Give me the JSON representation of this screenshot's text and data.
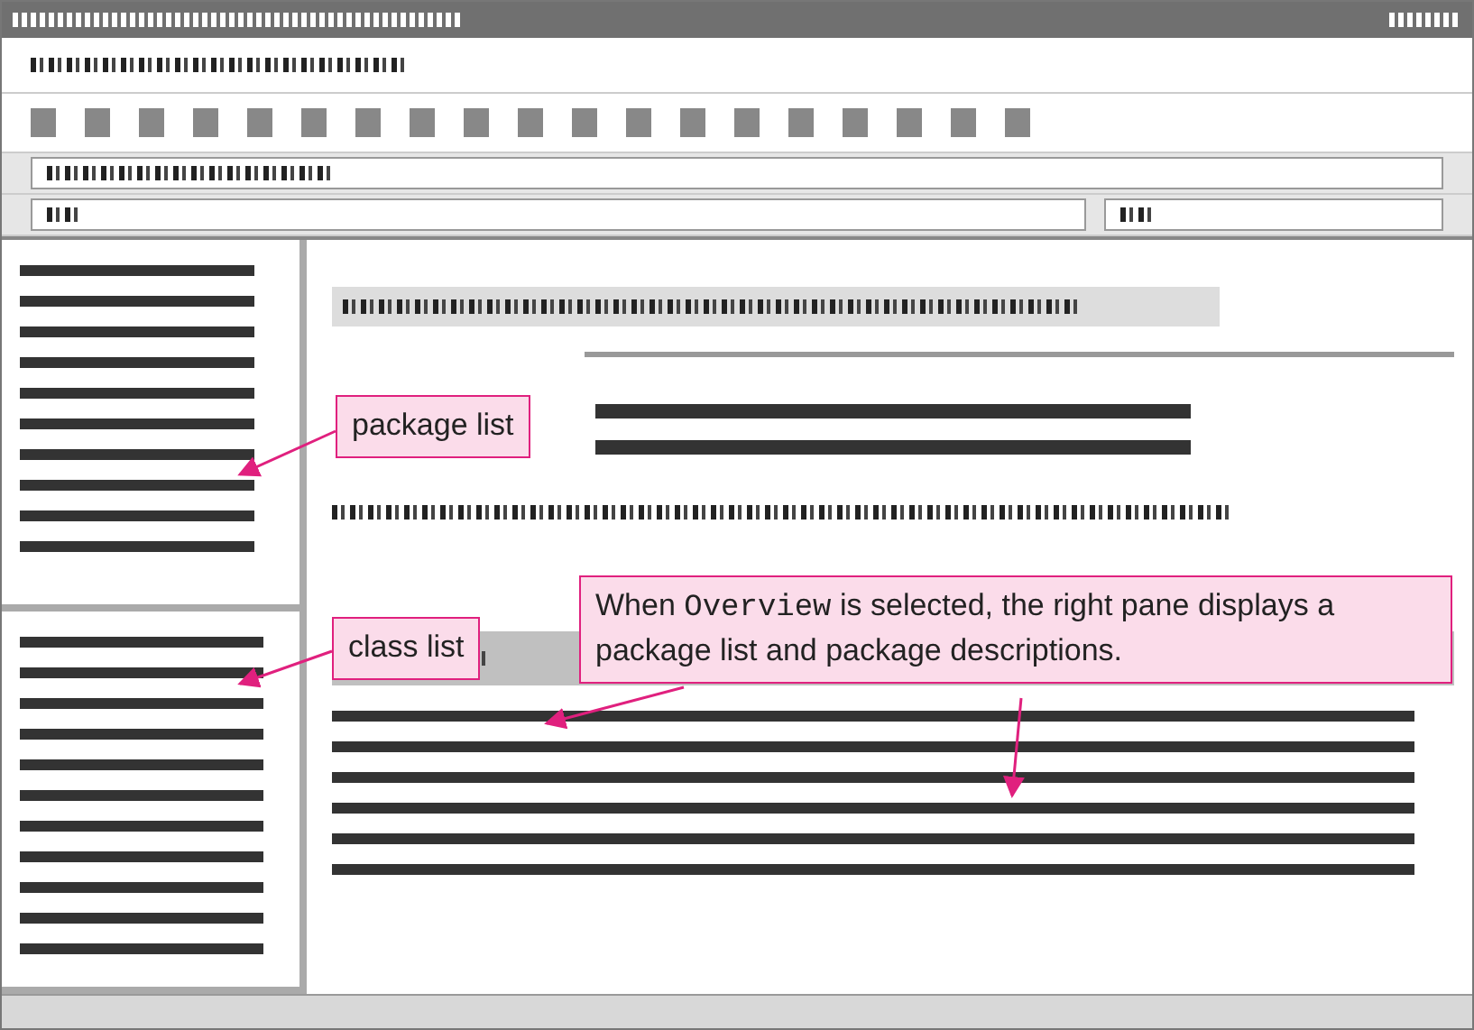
{
  "callouts": [
    {
      "kind": "label",
      "text": "package list"
    },
    {
      "kind": "label",
      "text": "class list"
    },
    {
      "kind": "note",
      "parts": [
        {
          "text": "When ",
          "code": false
        },
        {
          "text": "Overview",
          "code": true
        },
        {
          "text": " is selected, the right pane displays a package list and package descriptions.",
          "code": false
        }
      ]
    }
  ]
}
